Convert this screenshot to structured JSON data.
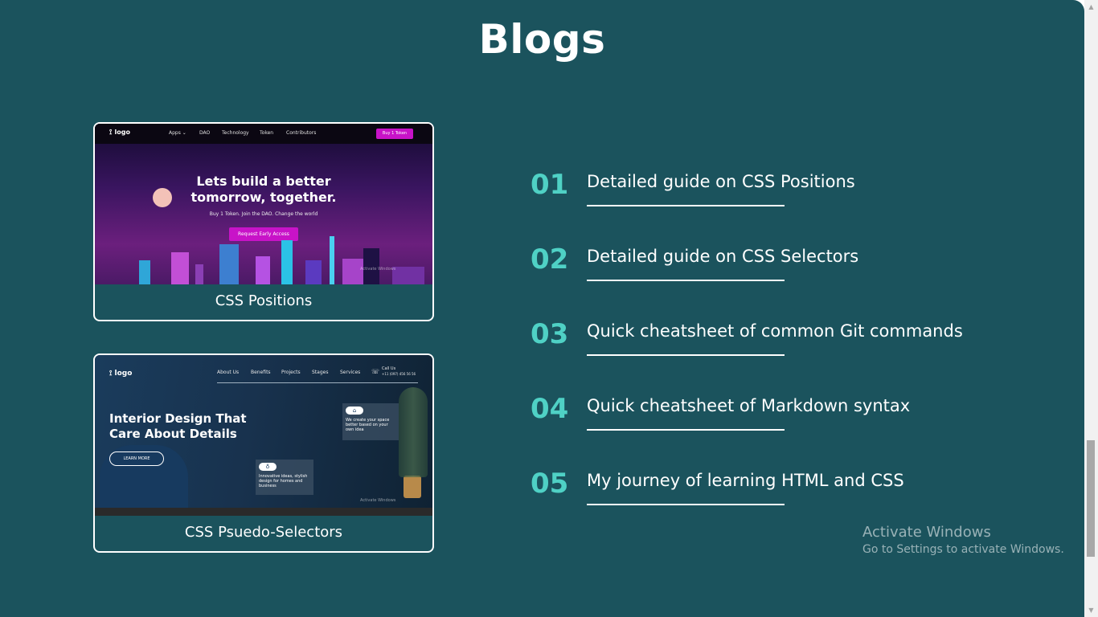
{
  "header": {
    "title": "Blogs"
  },
  "cards": [
    {
      "caption": "CSS Positions",
      "thumbnail": {
        "logo": "logo",
        "nav": [
          "Apps ⌄",
          "DAO",
          "Technology",
          "Token",
          "Contributors"
        ],
        "button": "Buy 1 Token",
        "headline": "Lets build a better tomorrow, together.",
        "subtext": "Buy 1 Token. Join the DAO. Change the world",
        "cta": "Request Early Access",
        "watermark": "Activate Windows"
      }
    },
    {
      "caption": "CSS Psuedo-Selectors",
      "thumbnail": {
        "logo": "logo",
        "nav": [
          "About Us",
          "Benefits",
          "Projects",
          "Stages",
          "Services",
          "Call Us"
        ],
        "phone": "+11 (097) 456 56 56",
        "headline": "Interior Design That Care About Details",
        "cta": "LEARN MORE",
        "box1": "We create your space better based on your own idea",
        "box2": "Innovative ideas, stylish design for homes and business",
        "watermark": "Activate Windows"
      }
    }
  ],
  "blogs": [
    {
      "number": "01",
      "title": "Detailed guide on CSS Positions"
    },
    {
      "number": "02",
      "title": "Detailed guide on CSS Selectors"
    },
    {
      "number": "03",
      "title": "Quick cheatsheet of common Git commands"
    },
    {
      "number": "04",
      "title": "Quick cheatsheet of Markdown syntax"
    },
    {
      "number": "05",
      "title": "My journey of learning HTML and CSS"
    }
  ],
  "os_watermark": {
    "line1": "Activate Windows",
    "line2": "Go to Settings to activate Windows."
  },
  "icons": [
    "wifi-logo-icon",
    "phone-icon",
    "home-icon",
    "bulb-icon",
    "scroll-up-arrow-icon",
    "scroll-down-arrow-icon"
  ]
}
